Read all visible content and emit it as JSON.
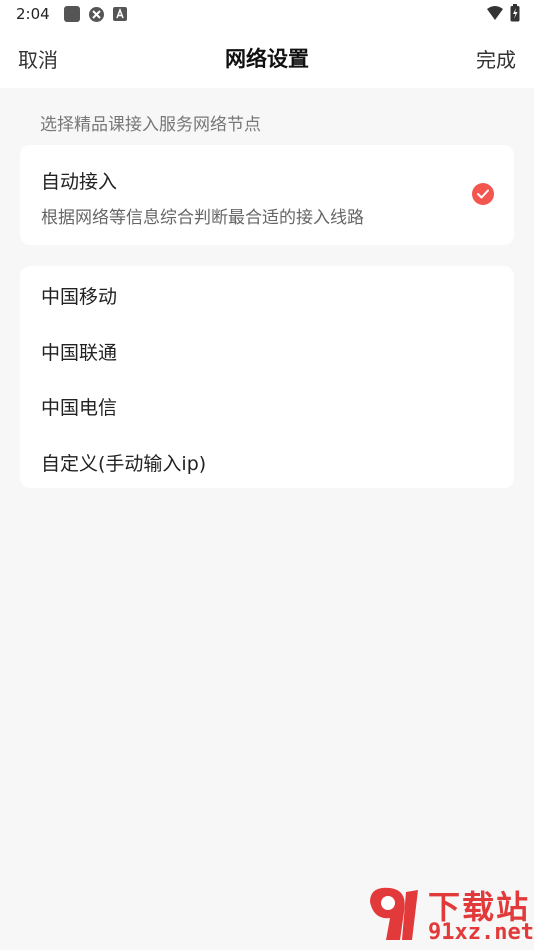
{
  "status_bar": {
    "time": "2:04",
    "icons_left": [
      "square-icon",
      "bluetooth-like-icon",
      "a-icon"
    ],
    "icons_right": [
      "wifi-icon",
      "battery-icon"
    ]
  },
  "nav": {
    "cancel_label": "取消",
    "title": "网络设置",
    "done_label": "完成"
  },
  "hint": "选择精品课接入服务网络节点",
  "auto_access": {
    "title": "自动接入",
    "description": "根据网络等信息综合判断最合适的接入线路",
    "selected": true,
    "check_color": "#f2564e"
  },
  "options": [
    {
      "label": "中国移动"
    },
    {
      "label": "中国联通"
    },
    {
      "label": "中国电信"
    },
    {
      "label": "自定义(手动输入ip)"
    }
  ],
  "watermark": {
    "logo_text": "91",
    "text_top": "下载站",
    "text_bottom": "91xz.net",
    "color": "#e23a3a"
  }
}
